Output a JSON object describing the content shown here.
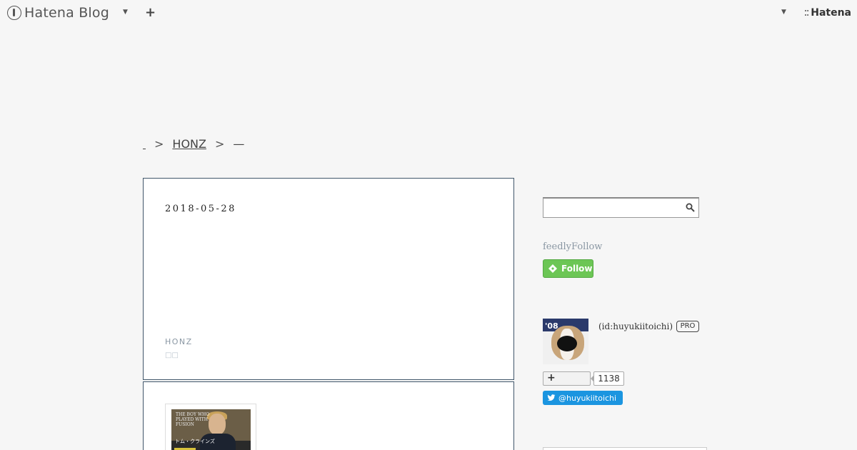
{
  "header": {
    "logo_text": "Hatena Blog",
    "add_symbol": "+",
    "hatena_label": "Hatena"
  },
  "breadcrumb": {
    "items": [
      "HONZ"
    ],
    "current": "—",
    "separator": ">"
  },
  "entry": {
    "date": "2018-05-28",
    "category": "HONZ",
    "tag": "□□"
  },
  "book": {
    "cover_text": "THE BOY WHO PLAYED WITH FUSION",
    "cover_jp": "トム・クラインズ"
  },
  "sidebar": {
    "feedly_title": "feedlyFollow",
    "follow_label": "Follow",
    "profile_id": "(id:huyukiitoichi)",
    "pro_badge": "PRO",
    "avatar_label": "'08",
    "readers_count": "1138",
    "twitter_label": "@huyukiitoichi"
  },
  "colors": {
    "background": "#f6f6f6",
    "entry_border": "#41566a",
    "feedly_green": "#6cc655",
    "twitter_blue": "#1b95e0"
  }
}
